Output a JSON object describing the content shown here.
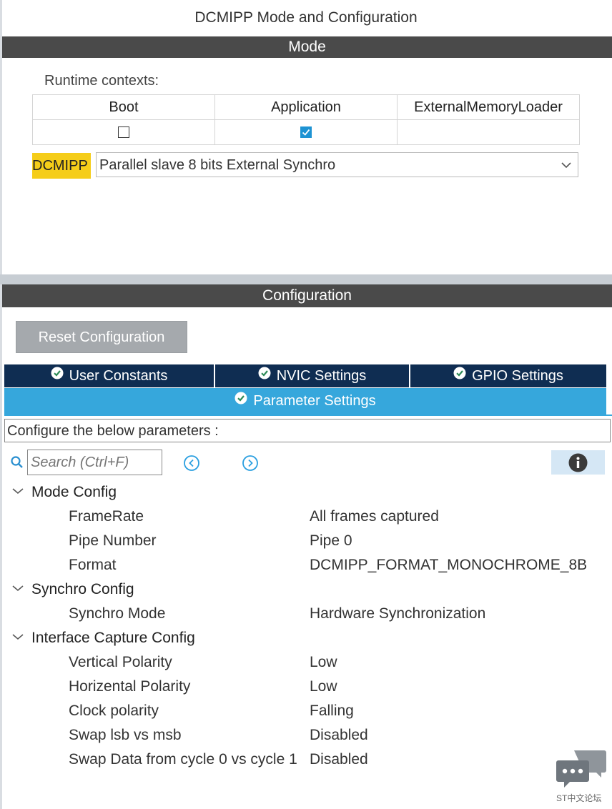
{
  "window": {
    "title": "DCMIPP Mode and Configuration"
  },
  "mode": {
    "header": "Mode",
    "runtime_label": "Runtime contexts:",
    "contexts": [
      {
        "name": "Boot",
        "checked": false
      },
      {
        "name": "Application",
        "checked": true
      },
      {
        "name": "ExternalMemoryLoader",
        "checked": null
      }
    ],
    "peripheral_label": "DCMIPP",
    "peripheral_value": "Parallel slave 8 bits External Synchro"
  },
  "configuration": {
    "header": "Configuration",
    "reset_label": "Reset Configuration",
    "tabs": [
      {
        "label": "User Constants"
      },
      {
        "label": "NVIC Settings"
      },
      {
        "label": "GPIO Settings"
      }
    ],
    "active_tab": "Parameter Settings",
    "description": "Configure the below parameters :",
    "search_placeholder": "Search (Ctrl+F)",
    "groups": [
      {
        "name": "Mode Config",
        "params": [
          {
            "name": "FrameRate",
            "value": "All frames captured"
          },
          {
            "name": "Pipe Number",
            "value": "Pipe 0"
          },
          {
            "name": "Format",
            "value": "DCMIPP_FORMAT_MONOCHROME_8B"
          }
        ]
      },
      {
        "name": "Synchro Config",
        "params": [
          {
            "name": "Synchro Mode",
            "value": "Hardware Synchronization"
          }
        ]
      },
      {
        "name": "Interface Capture Config",
        "params": [
          {
            "name": "Vertical Polarity",
            "value": "Low"
          },
          {
            "name": "Horizental Polarity",
            "value": "Low"
          },
          {
            "name": "Clock polarity",
            "value": "Falling"
          },
          {
            "name": "Swap lsb vs msb",
            "value": "Disabled"
          },
          {
            "name": "Swap Data from cycle 0 vs cycle 1",
            "value": "Disabled"
          }
        ]
      }
    ]
  },
  "watermark": {
    "text": "ST中文论坛"
  },
  "colors": {
    "dark_bar": "#4a4a4a",
    "tab_dark": "#0f2d52",
    "tab_active": "#36a7dc",
    "highlight": "#f5cd19",
    "check": "#1e93d3"
  }
}
